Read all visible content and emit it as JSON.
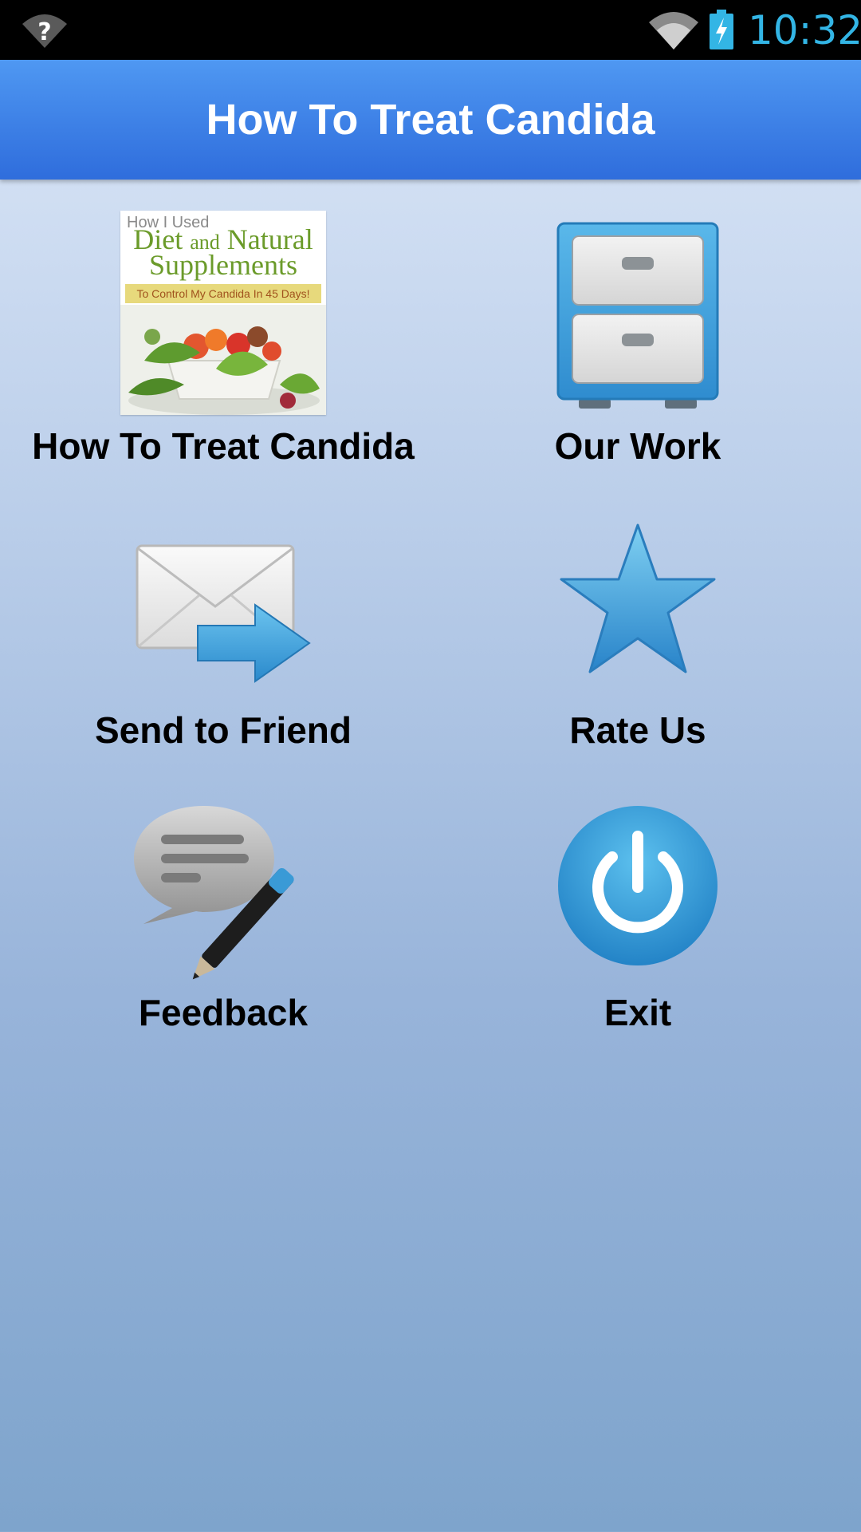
{
  "status_bar": {
    "time": "10:32",
    "icons": [
      "wifi-unknown-icon",
      "wifi-icon",
      "battery-charging-icon"
    ],
    "time_color": "#33b5e5"
  },
  "app_bar": {
    "title": "How To Treat Candida",
    "color": "#3d80e6"
  },
  "book_cover": {
    "pre": "How I Used",
    "line1_a": "Diet ",
    "line1_b": "and",
    "line1_c": " Natural",
    "line2": "Supplements",
    "band": "To Control My Candida In 45 Days!"
  },
  "menu": [
    {
      "label": "How To Treat Candida",
      "icon": "book-cover-icon"
    },
    {
      "label": "Our Work",
      "icon": "cabinet-icon"
    },
    {
      "label": "Send to Friend",
      "icon": "mail-send-icon"
    },
    {
      "label": "Rate Us",
      "icon": "star-icon"
    },
    {
      "label": "Feedback",
      "icon": "feedback-icon"
    },
    {
      "label": "Exit",
      "icon": "power-icon"
    }
  ]
}
